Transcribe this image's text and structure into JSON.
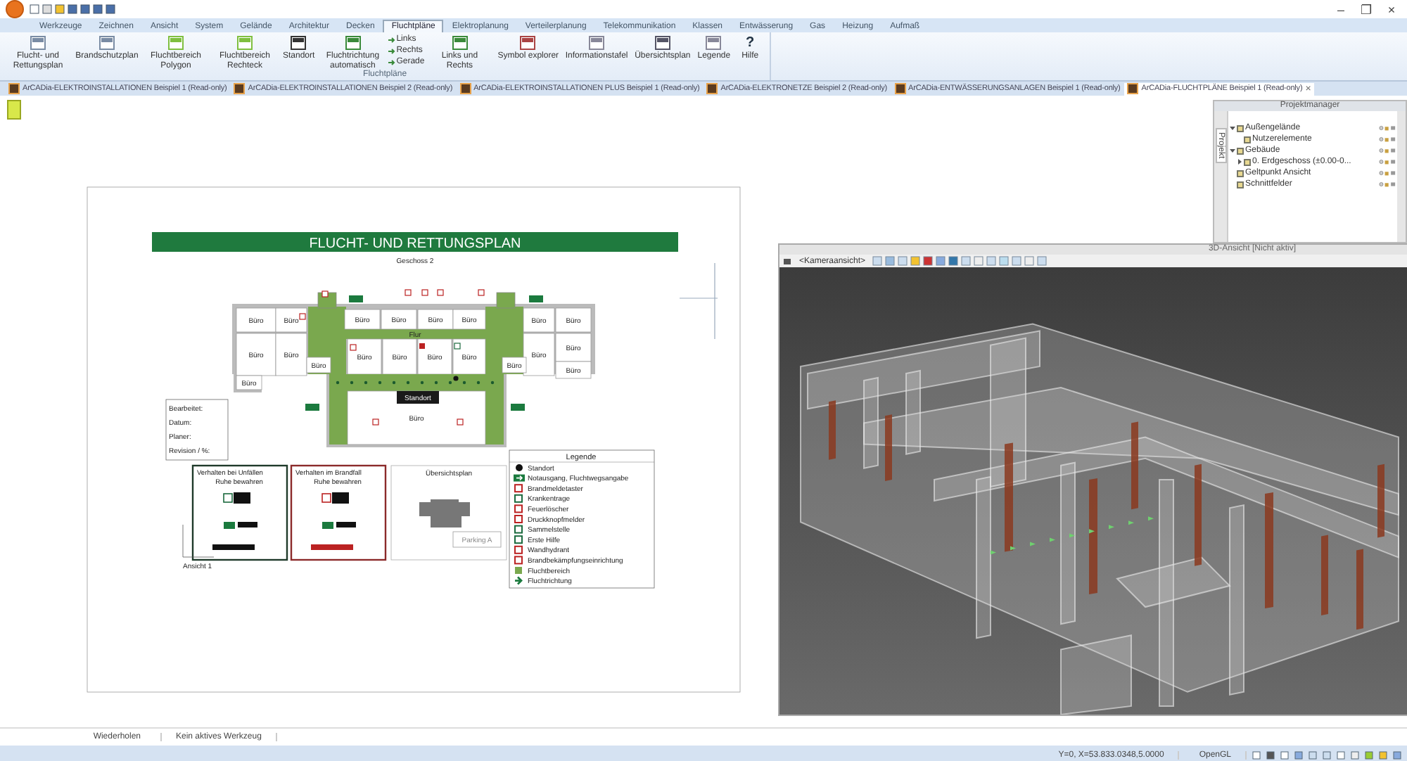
{
  "window_controls": [
    "–",
    "❐",
    "×"
  ],
  "ribbon_tabs": [
    {
      "label": "Werkzeuge",
      "selected": false
    },
    {
      "label": "Zeichnen",
      "selected": false
    },
    {
      "label": "Ansicht",
      "selected": false
    },
    {
      "label": "System",
      "selected": false
    },
    {
      "label": "Gelände",
      "selected": false
    },
    {
      "label": "Architektur",
      "selected": false
    },
    {
      "label": "Decken",
      "selected": false
    },
    {
      "label": "Fluchtpläne",
      "selected": true
    },
    {
      "label": "Elektroplanung",
      "selected": false
    },
    {
      "label": "Verteilerplanung",
      "selected": false
    },
    {
      "label": "Telekommunikation",
      "selected": false
    },
    {
      "label": "Klassen",
      "selected": false
    },
    {
      "label": "Entwässerung",
      "selected": false
    },
    {
      "label": "Gas",
      "selected": false
    },
    {
      "label": "Heizung",
      "selected": false
    },
    {
      "label": "Aufmaß",
      "selected": false
    }
  ],
  "ribbon_buttons": [
    {
      "kind": "large",
      "label": "Flucht- und Rettungsplan"
    },
    {
      "kind": "large",
      "label": "Brandschutzplan"
    },
    {
      "kind": "large",
      "label": "Fluchtbereich Polygon"
    },
    {
      "kind": "large",
      "label": "Fluchtbereich Rechteck"
    },
    {
      "kind": "large",
      "label": "Standort"
    },
    {
      "kind": "large",
      "label": "Fluchtrichtung automatisch"
    },
    {
      "kind": "stack",
      "items": [
        "Links",
        "Rechts",
        "Gerade"
      ]
    },
    {
      "kind": "large",
      "label": "Links und Rechts"
    },
    {
      "kind": "large",
      "label": "Symbol explorer"
    },
    {
      "kind": "large",
      "label": "Informationstafel"
    },
    {
      "kind": "large",
      "label": "Übersichtsplan"
    },
    {
      "kind": "large",
      "label": "Legende"
    },
    {
      "kind": "large",
      "label": "Hilfe",
      "glyph": "?"
    }
  ],
  "ribbon_group": "Fluchtpläne",
  "document_tabs": [
    {
      "label": "ArCADia-ELEKTROINSTALLATIONEN Beispiel 1 (Read-only)",
      "selected": false
    },
    {
      "label": "ArCADia-ELEKTROINSTALLATIONEN Beispiel 2 (Read-only)",
      "selected": false
    },
    {
      "label": "ArCADia-ELEKTROINSTALLATIONEN PLUS Beispiel 1 (Read-only)",
      "selected": false
    },
    {
      "label": "ArCADia-ELEKTRONETZE Beispiel 2 (Read-only)",
      "selected": false
    },
    {
      "label": "ArCADia-ENTWÄSSERUNGSANLAGEN Beispiel 1 (Read-only)",
      "selected": false
    },
    {
      "label": "ArCADia-FLUCHTPLÄNE Beispiel 1 (Read-only)",
      "selected": true
    }
  ],
  "document_tab_close": "×",
  "sheet": {
    "title": "FLUCHT- UND RETTUNGSPLAN",
    "subtitle": "Geschoss 2",
    "rooms": [
      "Büro",
      "Büro",
      "Büro",
      "Büro",
      "Büro",
      "Büro",
      "Büro",
      "Büro",
      "Büro",
      "Büro",
      "Büro",
      "Büro",
      "Büro",
      "Büro",
      "Büro",
      "Büro",
      "Büro",
      "Büro",
      "Büro",
      "Büro",
      "Büro"
    ],
    "corridor_label": "Flur",
    "location_label": "Standort",
    "info_fields": [
      "Bearbeitet:",
      "Datum:",
      "Planer:",
      "Revision / %:"
    ],
    "panels": [
      {
        "kind": "first-aid",
        "title": "Verhalten bei Unfällen",
        "subtitle": "Ruhe bewahren"
      },
      {
        "kind": "fire",
        "title": "Verhalten im Brandfall",
        "subtitle": "Ruhe bewahren"
      }
    ],
    "overview": {
      "title": "Übersichtsplan",
      "parking": "Parking A"
    },
    "legend": {
      "title": "Legende",
      "items": [
        {
          "kind": "dot",
          "label": "Standort"
        },
        {
          "kind": "exit",
          "label": "Notausgang, Fluchtwegsangabe"
        },
        {
          "kind": "red",
          "label": "Brandmeldetaster"
        },
        {
          "kind": "green",
          "label": "Krankentrage"
        },
        {
          "kind": "red",
          "label": "Feuerlöscher"
        },
        {
          "kind": "red",
          "label": "Druckknopfmelder"
        },
        {
          "kind": "green",
          "label": "Sammelstelle"
        },
        {
          "kind": "green",
          "label": "Erste Hilfe"
        },
        {
          "kind": "red",
          "label": "Wandhydrant"
        },
        {
          "kind": "red",
          "label": "Brandbekämpfungseinrichtung"
        },
        {
          "kind": "area",
          "label": "Fluchtbereich"
        },
        {
          "kind": "arrow",
          "label": "Fluchtrichtung"
        }
      ]
    },
    "view_label": "Ansicht 1"
  },
  "view3d": {
    "title": "3D-Ansicht [Nicht aktiv]",
    "camera": "<Kameraansicht>"
  },
  "project_manager": {
    "title": "Projektmanager",
    "side_tab": "Projekt",
    "tree": [
      {
        "label": "Außengelände",
        "expanded": true,
        "children": [
          {
            "label": "Nutzerelemente"
          }
        ]
      },
      {
        "label": "Gebäude",
        "expanded": true,
        "children": [
          {
            "label": "0. Erdgeschoss (±0.00-0...",
            "expanded": false
          }
        ]
      },
      {
        "label": "Geltpunkt Ansicht"
      },
      {
        "label": "Schnittfelder"
      }
    ]
  },
  "status": {
    "undo": "Wiederholen",
    "tool": "Kein aktives Werkzeug",
    "coords": "Y=0, X=53.833.0348,5.0000",
    "renderer": "OpenGL"
  }
}
